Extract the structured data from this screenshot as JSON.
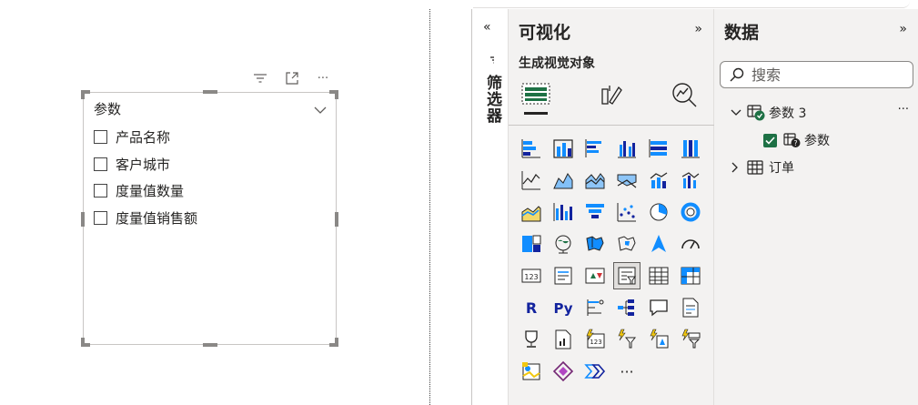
{
  "canvas": {
    "slicer": {
      "title": "参数",
      "items": [
        "产品名称",
        "客户城市",
        "度量值数量",
        "度量值销售额"
      ]
    },
    "header_icons": [
      "filter-lines-icon",
      "focus-mode-icon",
      "more-options-icon"
    ],
    "more_label": "···"
  },
  "filter_rail": {
    "collapse_glyph": "«",
    "label": "筛选器"
  },
  "viz_pane": {
    "title": "可视化",
    "expand_glyph": "»",
    "subtitle": "生成视觉对象",
    "tabs": [
      "build-visual-icon",
      "format-visual-icon",
      "analytics-icon"
    ],
    "more_label": "···"
  },
  "data_pane": {
    "title": "数据",
    "expand_glyph": "»",
    "search_placeholder": "搜索",
    "tree": {
      "table1": {
        "name": "参数 3",
        "more": "···"
      },
      "field1": {
        "name": "参数"
      },
      "table2": {
        "name": "订单"
      }
    }
  },
  "colors": {
    "pane_bg": "#f3f2f1",
    "accent_blue": "#118dff",
    "check_green": "#1e7145",
    "yellow": "#f2c811"
  }
}
